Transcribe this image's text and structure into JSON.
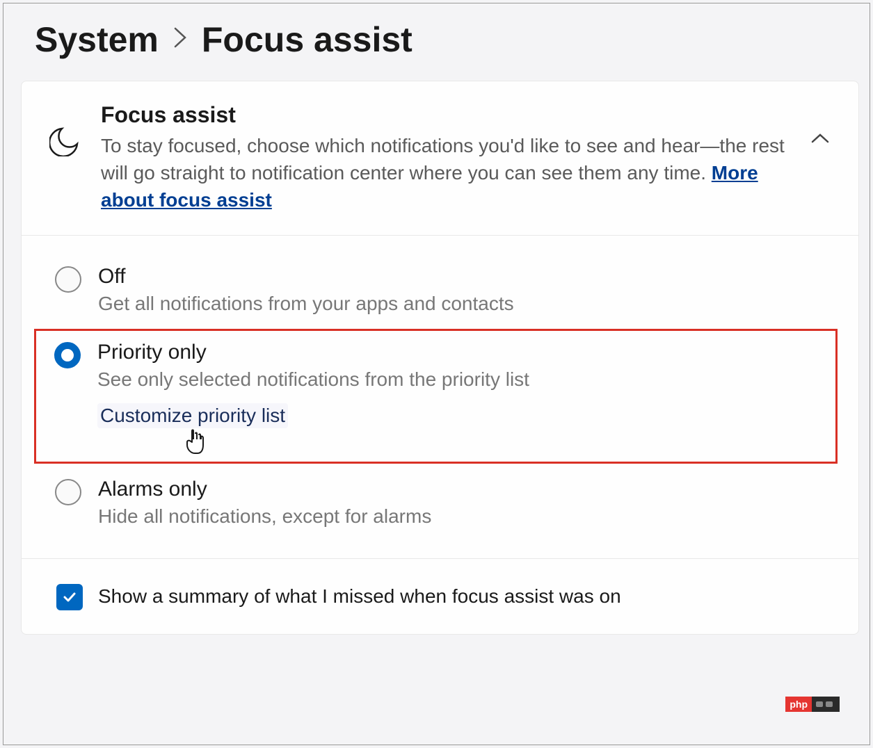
{
  "breadcrumb": {
    "parent": "System",
    "current": "Focus assist"
  },
  "header": {
    "title": "Focus assist",
    "description": "To stay focused, choose which notifications you'd like to see and hear—the rest will go straight to notification center where you can see them any time.  ",
    "link": "More about focus assist"
  },
  "options": {
    "off": {
      "label": "Off",
      "desc": "Get all notifications from your apps and contacts"
    },
    "priority": {
      "label": "Priority only",
      "desc": "See only selected notifications from the priority list",
      "customize": "Customize priority list"
    },
    "alarms": {
      "label": "Alarms only",
      "desc": "Hide all notifications, except for alarms"
    }
  },
  "summary": {
    "label": "Show a summary of what I missed when focus assist was on"
  },
  "watermark": {
    "text": "php"
  }
}
